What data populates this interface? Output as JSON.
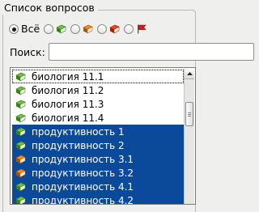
{
  "panel": {
    "title": "Список вопросов"
  },
  "filters": {
    "options": [
      {
        "label": "Всё",
        "checked": true,
        "icon": null
      },
      {
        "label": "",
        "checked": false,
        "icon": "book-green-icon",
        "color": "#6ec03c"
      },
      {
        "label": "",
        "checked": false,
        "icon": "book-orange-icon",
        "color": "#f28a1c"
      },
      {
        "label": "",
        "checked": false,
        "icon": "book-red-icon",
        "color": "#e8481e"
      },
      {
        "label": "",
        "checked": false,
        "icon": "flag-red-icon",
        "color": "#d01b1b"
      }
    ]
  },
  "search": {
    "label": "Поиск:",
    "value": "",
    "placeholder": ""
  },
  "list": {
    "items": [
      {
        "label": "биология 11.1",
        "icon": "book-green-icon",
        "selected": false
      },
      {
        "label": "биология 11.2",
        "icon": "book-green-icon",
        "selected": false
      },
      {
        "label": "биология 11.3",
        "icon": "book-green-icon",
        "selected": false
      },
      {
        "label": "биология 11.4",
        "icon": "book-green-icon",
        "selected": false
      },
      {
        "label": "продуктивность 1",
        "icon": "book-green-icon",
        "selected": true
      },
      {
        "label": "продуктивность 2",
        "icon": "book-green-icon",
        "selected": true
      },
      {
        "label": "продуктивность 3.1",
        "icon": "book-orange-icon",
        "selected": true
      },
      {
        "label": "продуктивность 3.2",
        "icon": "book-orange-icon",
        "selected": true
      },
      {
        "label": "продуктивность 4.1",
        "icon": "book-green-icon",
        "selected": true
      },
      {
        "label": "продуктивность 4.2",
        "icon": "book-green-icon",
        "selected": true
      }
    ]
  },
  "colors": {
    "selection": "#0b4a9b",
    "green": "#6ec03c",
    "orange": "#f28a1c",
    "red": "#e8481e"
  }
}
